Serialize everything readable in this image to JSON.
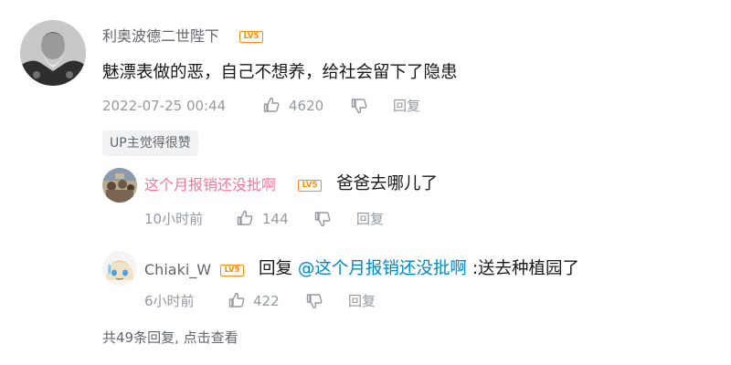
{
  "comment": {
    "username": "利奥波德二世陛下",
    "level": "LV5",
    "content": "魅漂表做的恶，自己不想养，给社会留下了隐患",
    "time": "2022-07-25 00:44",
    "likes": "4620",
    "reply_label": "回复",
    "up_badge": "UP主觉得很赞"
  },
  "replies": [
    {
      "username": "这个月报销还没批啊",
      "level": "LV5",
      "content": "爸爸去哪儿了",
      "time": "10小时前",
      "likes": "144",
      "reply_label": "回复"
    },
    {
      "username": "Chiaki_W",
      "level": "LV5",
      "reply_prefix": "回复",
      "mention": "@这个月报销还没批啊",
      "content": ":送去种植园了",
      "time": "6小时前",
      "likes": "422",
      "reply_label": "回复"
    }
  ],
  "view_more": "共49条回复, 点击查看",
  "icons": {
    "like": "thumbs-up-icon",
    "dislike": "thumbs-down-icon"
  },
  "colors": {
    "level_badge": "#ff8c00",
    "pink_username": "#fb7299",
    "mention": "#008ac5",
    "meta_gray": "#9499a0"
  }
}
